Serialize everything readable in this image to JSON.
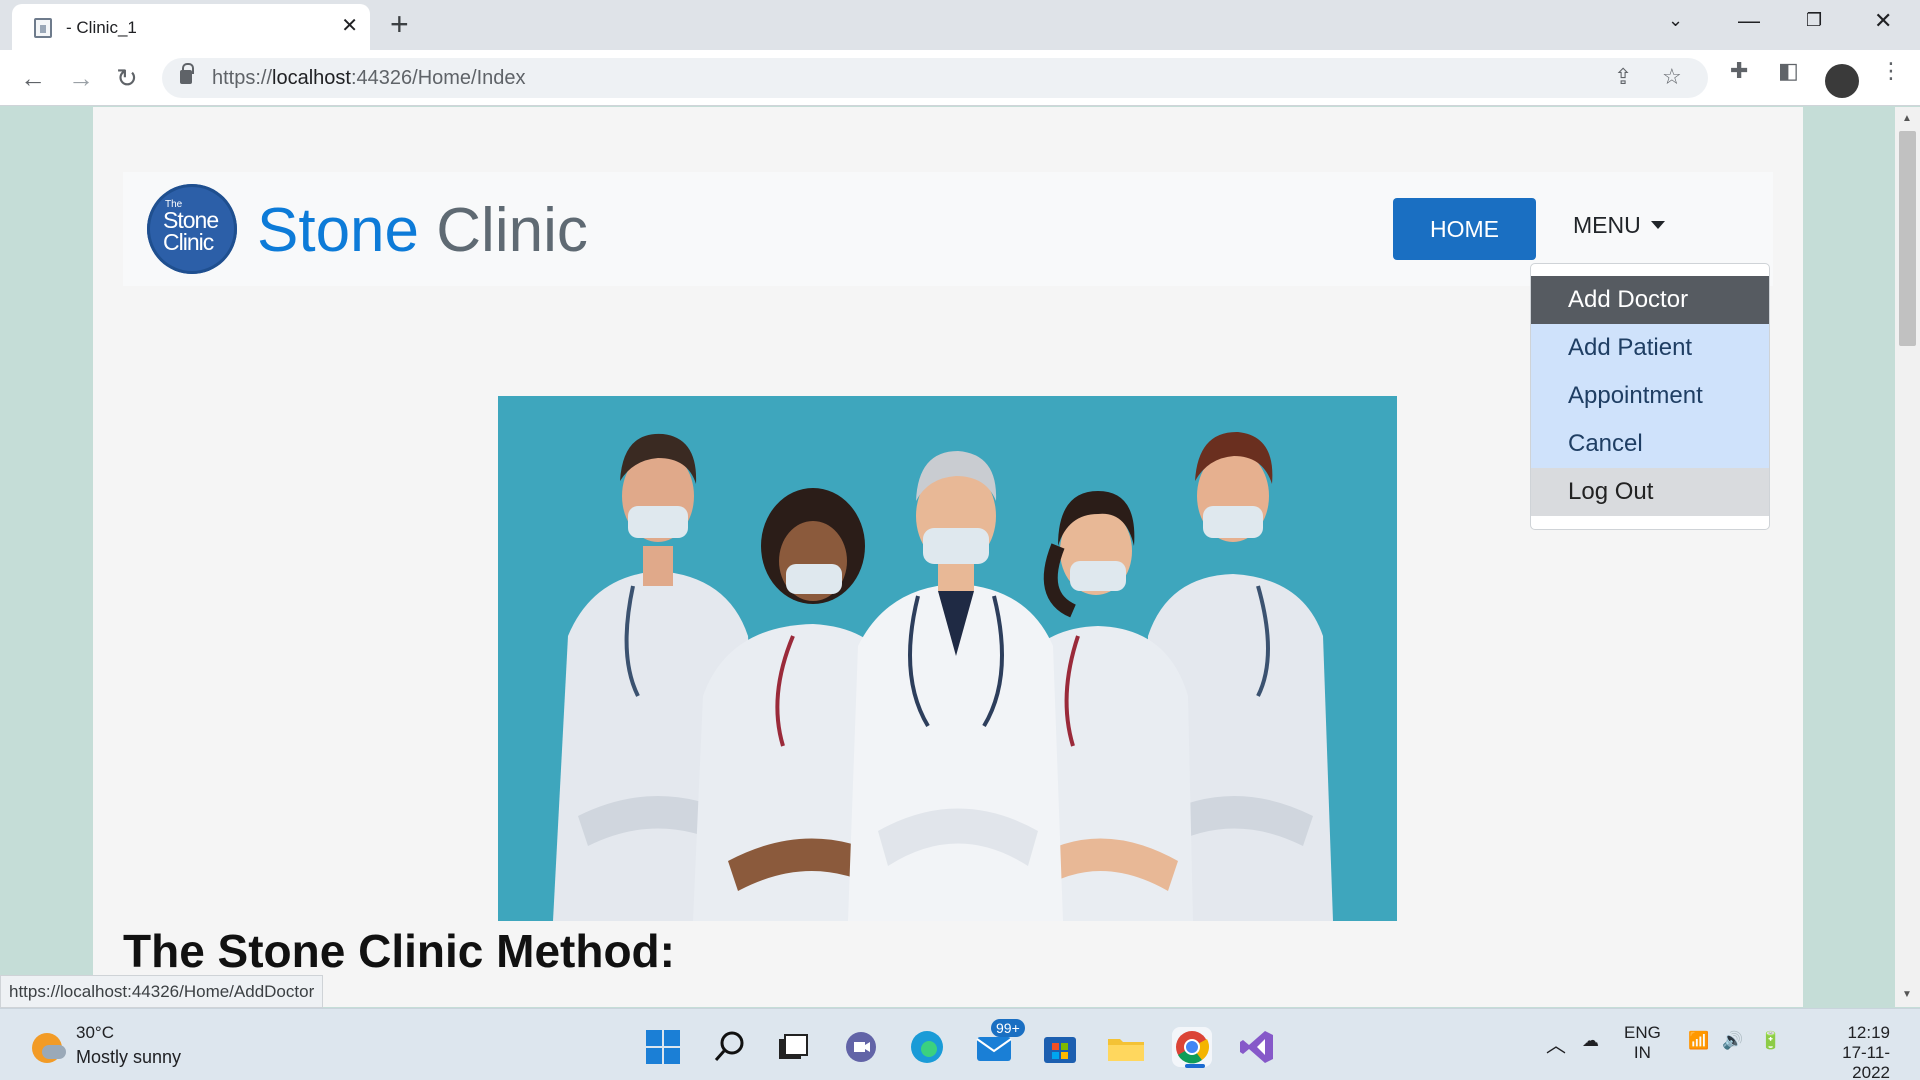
{
  "browser": {
    "tab_title": "- Clinic_1",
    "url_scheme": "https://",
    "url_host": "localhost",
    "url_rest": ":44326/Home/Index",
    "status_url": "https://localhost:44326/Home/AddDoctor"
  },
  "site": {
    "logo_small": "The",
    "logo_line1": "Stone",
    "logo_line2": "Clinic",
    "brand_part1": "Stone",
    "brand_part2": "Clinic",
    "home_label": "HOME",
    "menu_label": "MENU",
    "menu_items": [
      "Add Doctor",
      "Add Patient",
      "Appointment",
      "Cancel",
      "Log Out"
    ],
    "section_title": "The Stone Clinic Method:"
  },
  "taskbar": {
    "temperature": "30°C",
    "condition": "Mostly sunny",
    "mail_badge": "99+",
    "lang1": "ENG",
    "lang2": "IN",
    "time": "12:19",
    "date": "17-11-2022"
  },
  "colors": {
    "brand_blue": "#0d7bd8",
    "home_button": "#1a6fc2",
    "hero_bg": "#3ea6bd",
    "page_bg": "#c5ddd7"
  }
}
